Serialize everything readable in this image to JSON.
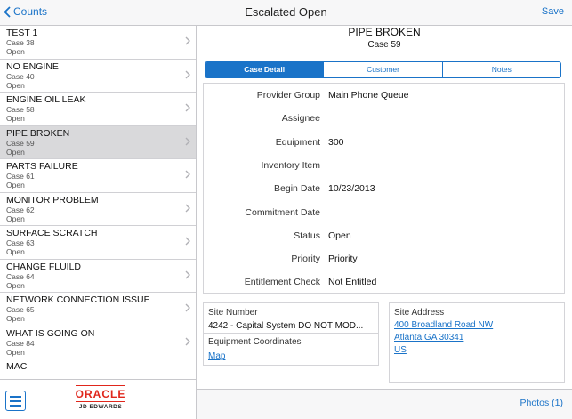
{
  "topbar": {
    "back_label": "Counts",
    "title": "Escalated Open",
    "save_label": "Save"
  },
  "list": [
    {
      "title": "TEST 1",
      "case": "Case 38",
      "status": "Open"
    },
    {
      "title": "NO ENGINE",
      "case": "Case 40",
      "status": "Open"
    },
    {
      "title": "ENGINE OIL LEAK",
      "case": "Case 58",
      "status": "Open"
    },
    {
      "title": "PIPE BROKEN",
      "case": "Case 59",
      "status": "Open"
    },
    {
      "title": "PARTS FAILURE",
      "case": "Case 61",
      "status": "Open"
    },
    {
      "title": "MONITOR PROBLEM",
      "case": "Case 62",
      "status": "Open"
    },
    {
      "title": "SURFACE SCRATCH",
      "case": "Case 63",
      "status": "Open"
    },
    {
      "title": "CHANGE FLUILD",
      "case": "Case 64",
      "status": "Open"
    },
    {
      "title": "NETWORK CONNECTION ISSUE",
      "case": "Case 65",
      "status": "Open"
    },
    {
      "title": "WHAT IS GOING ON",
      "case": "Case 84",
      "status": "Open"
    },
    {
      "title": "MAC",
      "case": "",
      "status": ""
    }
  ],
  "selected_index": 3,
  "logo": {
    "oracle": "ORACLE",
    "jde": "JD EDWARDS"
  },
  "detail": {
    "title": "PIPE BROKEN",
    "subtitle": "Case 59",
    "tabs": [
      "Case Detail",
      "Customer",
      "Notes"
    ],
    "fields": [
      {
        "label": "Provider Group",
        "value": "Main Phone Queue"
      },
      {
        "label": "Assignee",
        "value": ""
      },
      {
        "label": "Equipment",
        "value": "300"
      },
      {
        "label": "Inventory Item",
        "value": ""
      },
      {
        "label": "Begin Date",
        "value": "10/23/2013"
      },
      {
        "label": "Commitment Date",
        "value": ""
      },
      {
        "label": "Status",
        "value": "Open"
      },
      {
        "label": "Priority",
        "value": "Priority"
      },
      {
        "label": "Entitlement Check",
        "value": "Not Entitled"
      }
    ],
    "site_number_label": "Site Number",
    "site_number_value": "4242 - Capital System DO NOT MOD...",
    "equipment_coords_label": "Equipment Coordinates",
    "map_link": "Map",
    "site_address_label": "Site Address",
    "address_line1": "400 Broadland Road NW",
    "address_line2": "Atlanta GA  30341",
    "address_line3": "US"
  },
  "bottom": {
    "photos_label": "Photos (1)"
  },
  "colors": {
    "accent": "#1a73c8",
    "selected_row": "#d9d9db",
    "oracle_red": "#e0261b"
  }
}
